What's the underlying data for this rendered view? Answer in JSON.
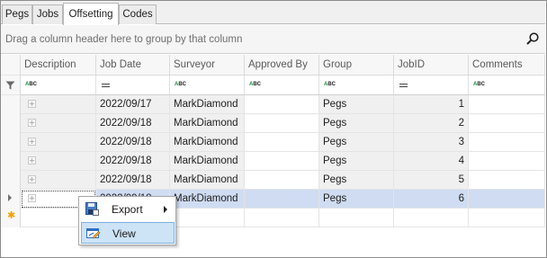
{
  "tabs": [
    {
      "label": "Pegs"
    },
    {
      "label": "Jobs"
    },
    {
      "label": "Offsetting"
    },
    {
      "label": "Codes"
    }
  ],
  "active_tab": "Offsetting",
  "group_panel": {
    "hint": "Drag a column header here to group by that column"
  },
  "columns": [
    {
      "label": "Description",
      "filter": "text"
    },
    {
      "label": "Job Date",
      "filter": "equals"
    },
    {
      "label": "Surveyor",
      "filter": "text"
    },
    {
      "label": "Approved By",
      "filter": "text"
    },
    {
      "label": "Group",
      "filter": "text"
    },
    {
      "label": "JobID",
      "filter": "equals"
    },
    {
      "label": "Comments",
      "filter": "text"
    }
  ],
  "rows": [
    {
      "job_date": "2022/09/17",
      "surveyor": "MarkDiamond",
      "approved_by": "",
      "group": "Pegs",
      "job_id": "1",
      "comments": ""
    },
    {
      "job_date": "2022/09/18",
      "surveyor": "MarkDiamond",
      "approved_by": "",
      "group": "Pegs",
      "job_id": "2",
      "comments": ""
    },
    {
      "job_date": "2022/09/18",
      "surveyor": "MarkDiamond",
      "approved_by": "",
      "group": "Pegs",
      "job_id": "3",
      "comments": ""
    },
    {
      "job_date": "2022/09/18",
      "surveyor": "MarkDiamond",
      "approved_by": "",
      "group": "Pegs",
      "job_id": "4",
      "comments": ""
    },
    {
      "job_date": "2022/09/18",
      "surveyor": "MarkDiamond",
      "approved_by": "",
      "group": "Pegs",
      "job_id": "5",
      "comments": ""
    },
    {
      "job_date": "2022/09/18",
      "surveyor": "MarkDiamond",
      "approved_by": "",
      "group": "Pegs",
      "job_id": "6",
      "comments": ""
    }
  ],
  "context_menu": {
    "items": [
      {
        "label": "Export",
        "icon": "export-icon",
        "has_submenu": true
      },
      {
        "label": "View",
        "icon": "view-icon",
        "highlighted": true
      }
    ]
  },
  "filter_glyph": {
    "abc_top": "A",
    "abc_bottom": "BC"
  },
  "colors": {
    "selected_row": "#cfdcf2",
    "menu_highlight": "#cde3f6",
    "new_row_star": "#f5a000",
    "abc_green": "#1f8b3a"
  }
}
